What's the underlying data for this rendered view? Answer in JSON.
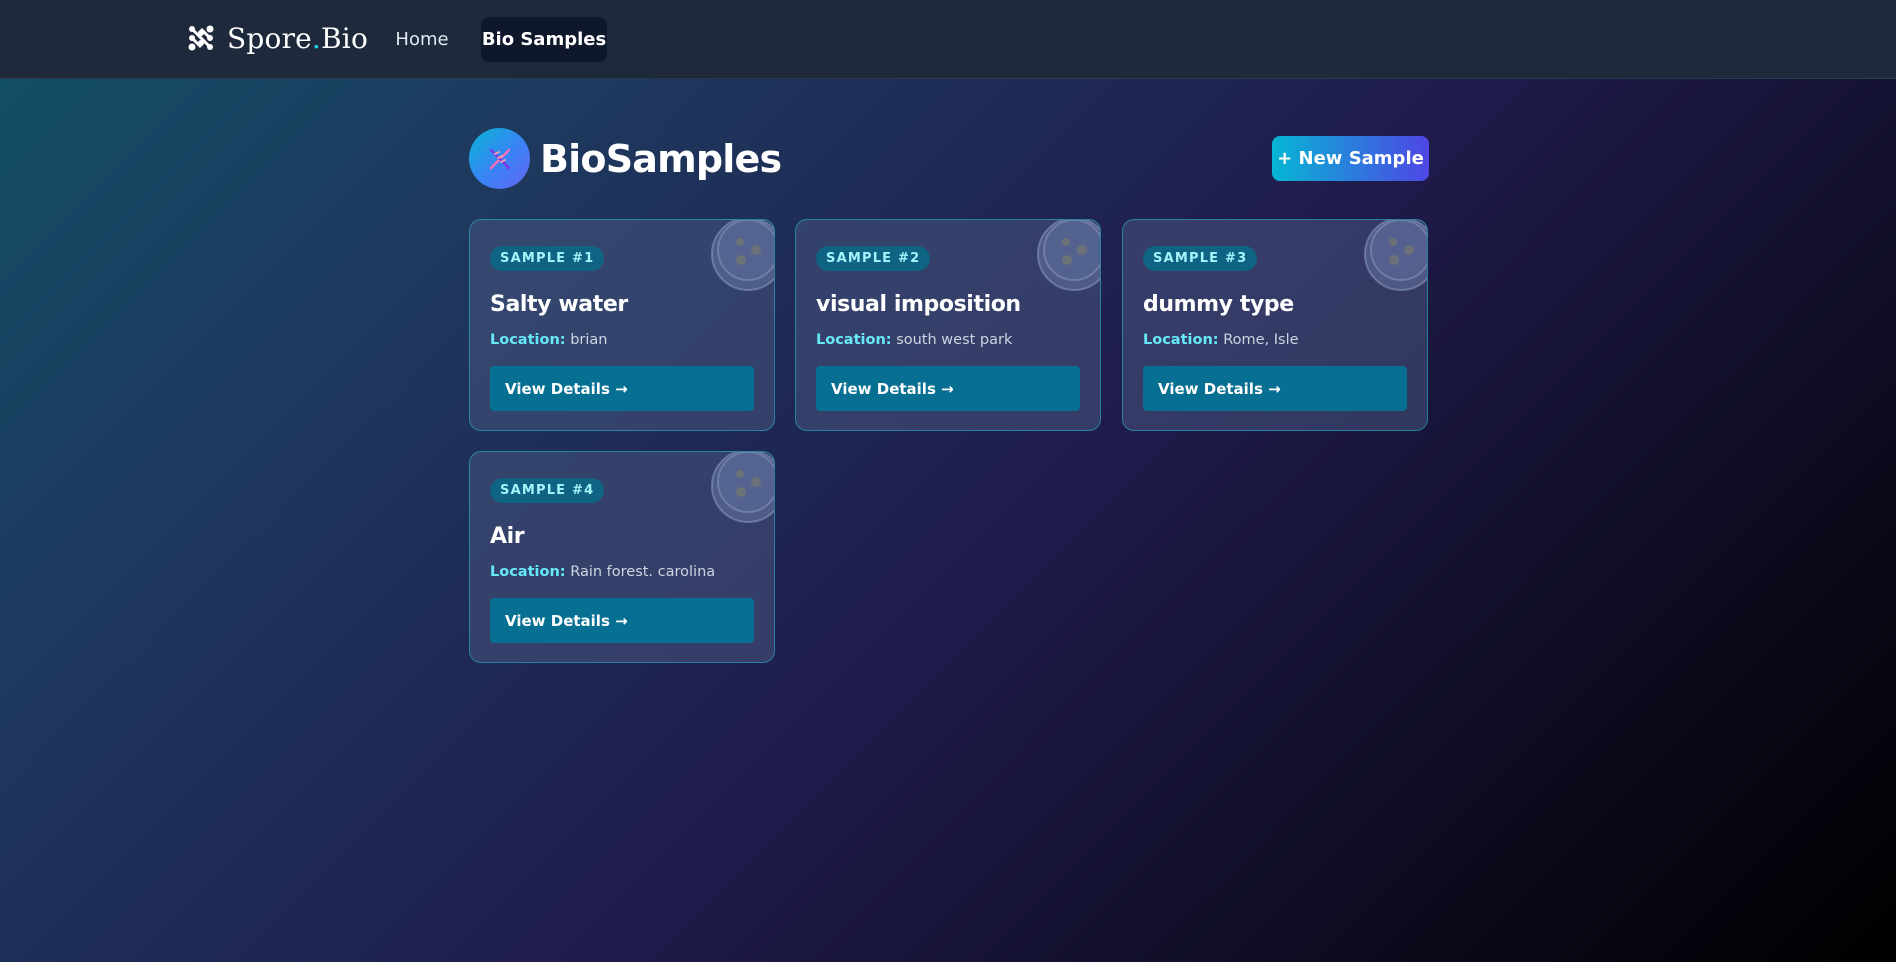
{
  "nav": {
    "brand_name": "Spore",
    "brand_dot": ".",
    "brand_suffix": "Bio",
    "links": [
      {
        "label": "Home"
      },
      {
        "label": "Bio Samples"
      }
    ]
  },
  "header": {
    "title": "BioSamples",
    "new_button_label": "+ New Sample"
  },
  "samples": [
    {
      "badge": "SAMPLE #1",
      "title": "Salty water",
      "location_label": "Location:",
      "location": "brian",
      "button_label": "View Details →"
    },
    {
      "badge": "SAMPLE #2",
      "title": "visual imposition",
      "location_label": "Location:",
      "location": "south west park",
      "button_label": "View Details →"
    },
    {
      "badge": "SAMPLE #3",
      "title": "dummy type",
      "location_label": "Location:",
      "location": "Rome, Isle",
      "button_label": "View Details →"
    },
    {
      "badge": "SAMPLE #4",
      "title": "Air",
      "location_label": "Location:",
      "location": "Rain forest. carolina",
      "button_label": "View Details →"
    }
  ],
  "icons": {
    "brand": "spore-logo-icon",
    "page": "dna-icon",
    "card_decoration": "petri-dish-icon"
  },
  "colors": {
    "nav_bg": "#1e293b",
    "accent_cyan": "#06b6d4",
    "accent_indigo": "#4f46e5",
    "button_teal": "#076f91",
    "badge_bg": "#0e6482"
  }
}
